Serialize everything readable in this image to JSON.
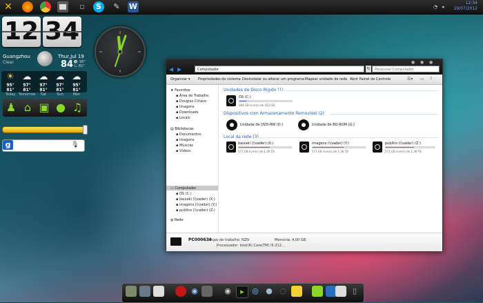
{
  "taskbar": {
    "icons": [
      "windows-flag",
      "firefox",
      "chrome",
      "folder",
      "skype",
      "notepad",
      "word"
    ],
    "word_letter": "W",
    "clock_time": "12:34",
    "clock_date": "19/07/2012"
  },
  "clock_widget": {
    "hours": "12",
    "minutes": "34",
    "city": "Guangzhou",
    "condition": "Clear",
    "date": "Thur,Jul 19",
    "temp": "84°",
    "high": "H: 95°",
    "low": "L: 81°",
    "forecast": [
      {
        "temps": "95° 81°",
        "day": "Today"
      },
      {
        "temps": "97° 81°",
        "day": "Tomorrow"
      },
      {
        "temps": "97° 81°",
        "day": "Sat"
      },
      {
        "temps": "97° 81°",
        "day": "Sun"
      },
      {
        "temps": "95° 81°",
        "day": "Mon"
      }
    ]
  },
  "google_search": {
    "logo": "g",
    "placeholder": ""
  },
  "explorer": {
    "address": "Computador",
    "search_placeholder": "Pesquisar Computador",
    "toolbar": [
      "Organizar ▾",
      "Propriedades do sistema",
      "Desinstalar ou alterar um programa",
      "Mapear unidade de rede",
      "Abrir Painel de Controle"
    ],
    "nav": {
      "favorites": "Favoritos",
      "fav_items": [
        "Área de Trabalho",
        "Douglas Ciriaco",
        "Imagens",
        "Downloads",
        "Locais"
      ],
      "libraries": "Bibliotecas",
      "lib_items": [
        "Documentos",
        "Imagens",
        "Músicas",
        "Vídeos"
      ],
      "computer": "Computador",
      "comp_items": [
        "OS (C:)",
        "baixaki (\\\\vader) (X:)",
        "imagens (\\\\vader) (Y:)",
        "publico (\\\\vader) (Z:)"
      ],
      "network": "Rede"
    },
    "groups": {
      "hdd": "Unidades de Disco Rígido (1)",
      "removable": "Dispositivos com Armazenamento Removível (2)",
      "network": "Local da rede (3)"
    },
    "drives": {
      "os": {
        "name": "OS (C:)",
        "space": "394 GB livre(s) de 452 GB",
        "used_fraction": 0.13
      },
      "dvd": "Unidade de DVD-RW (D:)",
      "bd": "Unidade de BD-ROM (G:)",
      "net": [
        {
          "name": "baixaki (\\\\vader) (X:)",
          "space": "571 GB livre(s) de 1,36 TB",
          "used_fraction": 0.59
        },
        {
          "name": "imagens (\\\\vader) (Y:)",
          "space": "571 GB livre(s) de 1,36 TB",
          "used_fraction": 0.59
        },
        {
          "name": "publico (\\\\vader) (Z:)",
          "space": "571 GB livre(s) de 1,36 TB",
          "used_fraction": 0.59
        }
      ]
    },
    "details": {
      "pc_name": "PC000634",
      "workgroup": "Grupo de trabalho: NZN",
      "memory": "Memória: 4,00 GB",
      "processor": "Processador: Intel(R) Core(TM) i5-212..."
    }
  },
  "dock": {
    "labels": [
      "",
      "",
      "",
      "",
      "",
      "",
      "",
      "",
      "",
      "",
      "",
      "",
      "",
      "",
      "",
      "",
      "",
      ""
    ]
  }
}
